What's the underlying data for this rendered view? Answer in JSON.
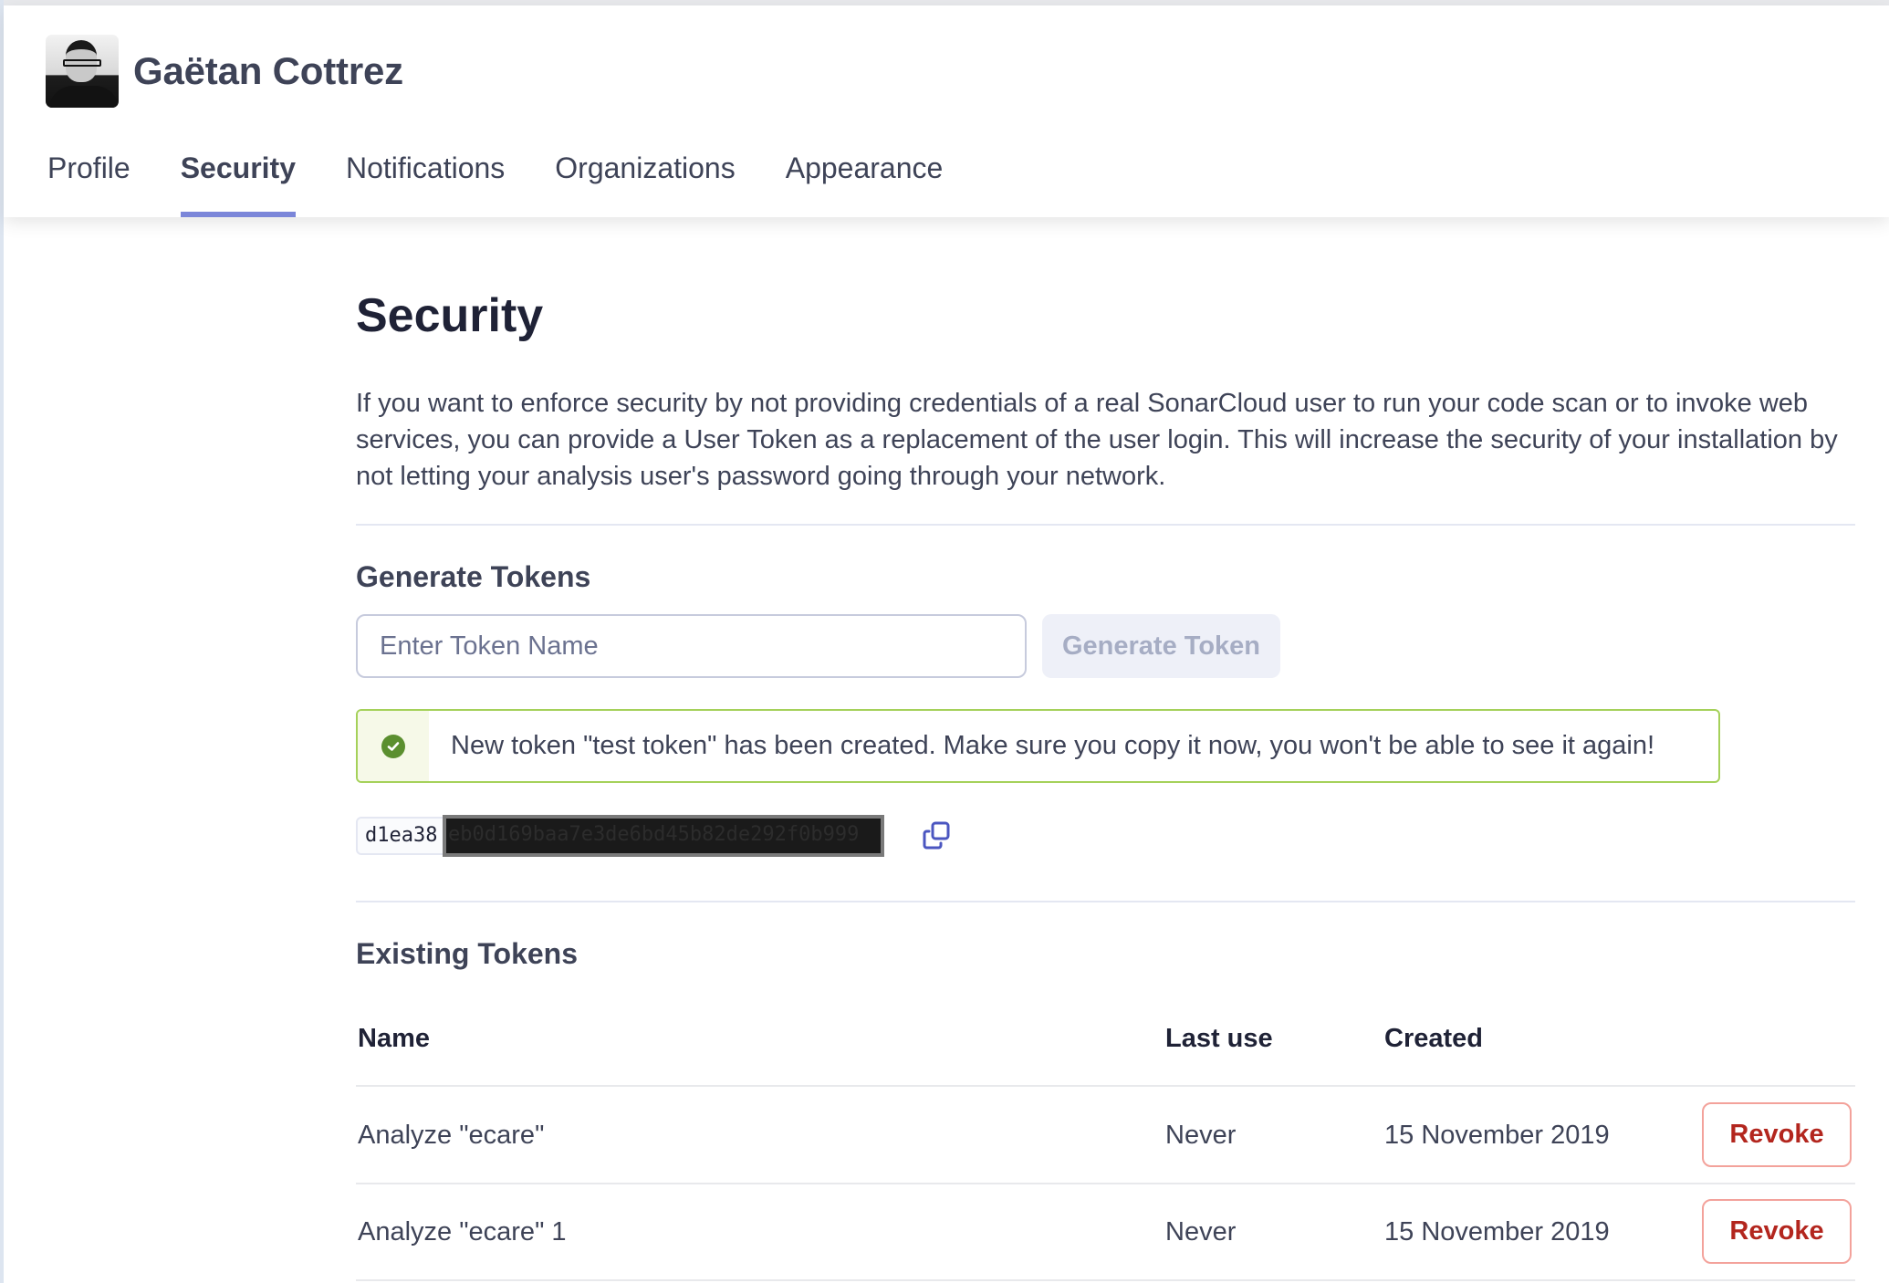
{
  "user": {
    "name": "Gaëtan Cottrez",
    "avatar_icon": "user-avatar-photo"
  },
  "tabs": [
    {
      "label": "Profile",
      "active": false
    },
    {
      "label": "Security",
      "active": true
    },
    {
      "label": "Notifications",
      "active": false
    },
    {
      "label": "Organizations",
      "active": false
    },
    {
      "label": "Appearance",
      "active": false
    }
  ],
  "page": {
    "title": "Security",
    "intro": "If you want to enforce security by not providing credentials of a real SonarCloud user to run your code scan or to invoke web services, you can provide a User Token as a replacement of the user login. This will increase the security of your installation by not letting your analysis user's password going through your network."
  },
  "generate": {
    "title": "Generate Tokens",
    "input_placeholder": "Enter Token Name",
    "input_value": "",
    "button_label": "Generate Token",
    "button_disabled": true
  },
  "alert": {
    "icon": "check-circle-icon",
    "message": "New token \"test token\" has been created. Make sure you copy it now, you won't be able to see it again!",
    "border_color": "#a5d15a"
  },
  "new_token": {
    "visible_prefix": "d1ea38",
    "redacted_part": "eb0d169baa7e3de6bd45b82de292f0b999",
    "copy_icon": "copy-icon"
  },
  "existing": {
    "title": "Existing Tokens",
    "columns": [
      "Name",
      "Last use",
      "Created"
    ],
    "rows": [
      {
        "name": "Analyze \"ecare\"",
        "last_use": "Never",
        "created": "15 November 2019",
        "action": "Revoke"
      },
      {
        "name": "Analyze \"ecare\" 1",
        "last_use": "Never",
        "created": "15 November 2019",
        "action": "Revoke"
      }
    ]
  },
  "colors": {
    "accent": "#7b86d9",
    "danger": "#b3261e",
    "success": "#5b8f2f",
    "text": "#3e4357"
  }
}
